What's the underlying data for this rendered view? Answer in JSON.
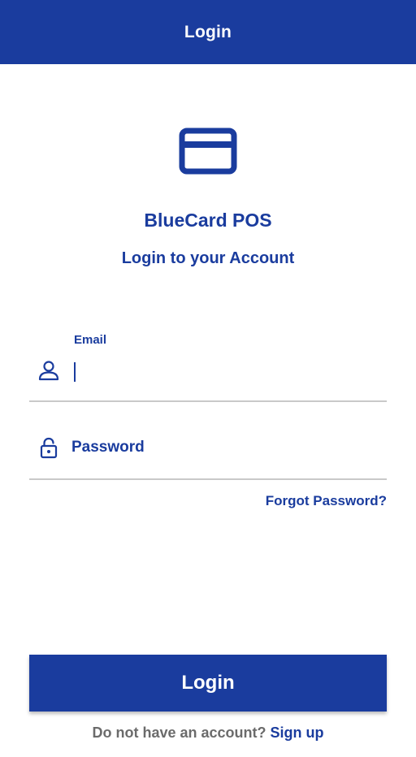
{
  "appbar": {
    "title": "Login"
  },
  "brand": {
    "name": "BlueCard POS",
    "subtitle": "Login to your Account"
  },
  "form": {
    "email": {
      "label": "Email",
      "value": ""
    },
    "password": {
      "placeholder": "Password",
      "value": ""
    },
    "forgot_label": "Forgot Password?"
  },
  "actions": {
    "login_label": "Login",
    "signup_prompt": "Do not have an account?",
    "signup_label": "Sign up"
  },
  "icons": {
    "logo": "credit-card-icon",
    "email": "person-icon",
    "password": "padlock-icon"
  },
  "colors": {
    "primary": "#1a3c9e",
    "muted_text": "#6b6b6b",
    "underline": "#c9c9c9",
    "background": "#ffffff"
  }
}
